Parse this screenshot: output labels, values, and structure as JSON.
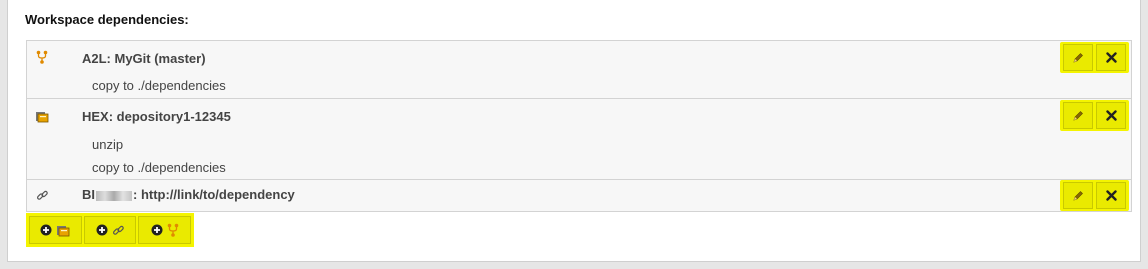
{
  "heading": "Workspace dependencies:",
  "dependencies": [
    {
      "icon": "git-branch-icon",
      "title": "A2L: MyGit (master)",
      "steps": [
        "copy to ./dependencies"
      ]
    },
    {
      "icon": "depository-icon",
      "title": "HEX: depository1-12345",
      "steps": [
        "unzip",
        "copy to ./dependencies"
      ]
    },
    {
      "icon": "link-icon",
      "title_prefix": "BI",
      "title_rest": ": http://link/to/dependency",
      "steps": []
    }
  ],
  "add_buttons": [
    {
      "icon": "add-depository-icon"
    },
    {
      "icon": "add-link-icon"
    },
    {
      "icon": "add-git-icon"
    }
  ],
  "colors": {
    "highlight": "#f4f400",
    "git_icon": "#e08a00"
  }
}
